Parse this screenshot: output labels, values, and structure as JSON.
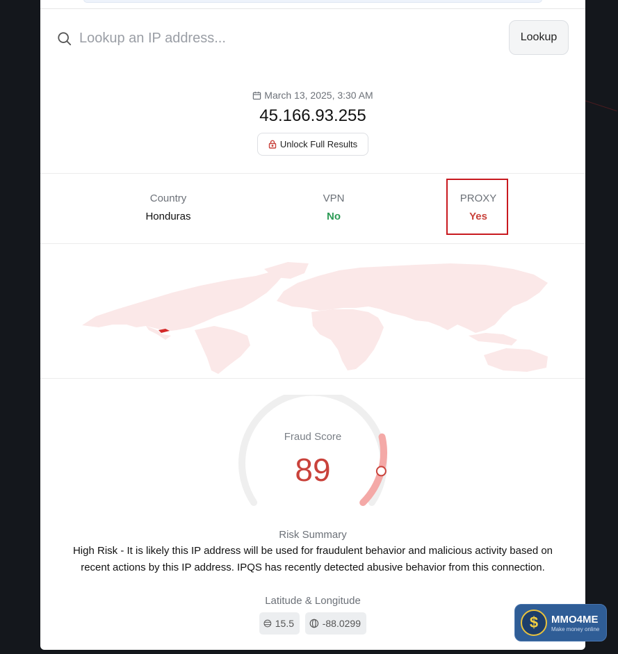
{
  "search": {
    "placeholder": "Lookup an IP address...",
    "button_label": "Lookup"
  },
  "result": {
    "date": "March 13, 2025, 3:30 AM",
    "ip": "45.166.93.255",
    "unlock_label": "Unlock Full Results"
  },
  "stats": {
    "country": {
      "label": "Country",
      "value": "Honduras"
    },
    "vpn": {
      "label": "VPN",
      "value": "No",
      "color": "#2c9b55"
    },
    "proxy": {
      "label": "PROXY",
      "value": "Yes",
      "color": "#c9423b"
    }
  },
  "map": {
    "highlighted_country": "Honduras",
    "land_color": "#fbe8e8",
    "highlight_color": "#d42a2a"
  },
  "fraud": {
    "label": "Fraud Score",
    "score": "89",
    "score_fraction": 0.89,
    "color": "#c9423b"
  },
  "risk": {
    "title": "Risk Summary",
    "text": "High Risk - It is likely this IP address will be used for fraudulent behavior and malicious activity based on recent actions by this IP address. IPQS has recently detected abusive behavior from this connection."
  },
  "location": {
    "title": "Latitude & Longitude",
    "latitude": "15.5",
    "longitude": "-88.0299"
  },
  "watermark": {
    "name": "MMO4ME",
    "tagline": "Make money online"
  },
  "icons": {
    "search": "search-icon",
    "calendar": "calendar-icon",
    "lock": "lock-icon",
    "latitude": "latitude-icon",
    "longitude": "globe-icon",
    "coin": "dollar-coin-icon"
  }
}
